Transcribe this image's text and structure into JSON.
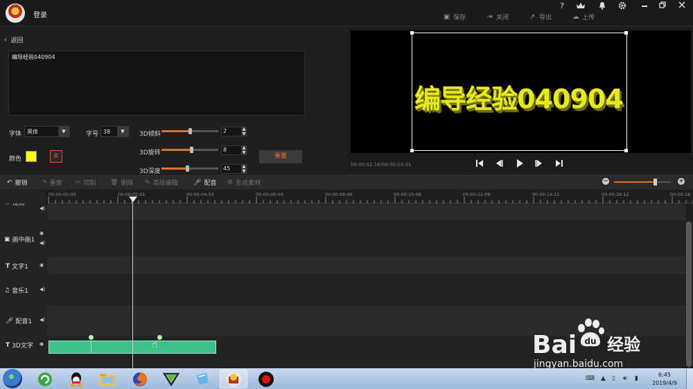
{
  "header": {
    "login": "登录",
    "icons": [
      "help-icon",
      "vip-icon",
      "bell-icon",
      "settings-icon",
      "minimize-icon",
      "restore-icon",
      "close-icon"
    ],
    "help_glyph": "?",
    "actions": [
      {
        "label": "保存",
        "icon": "save-icon"
      },
      {
        "label": "关闭",
        "icon": "exit-icon"
      },
      {
        "label": "导出",
        "icon": "export-icon"
      },
      {
        "label": "上传",
        "icon": "upload-icon"
      }
    ]
  },
  "editor": {
    "back_label": "返回",
    "text_value": "编导经验040904",
    "font_label": "字体",
    "font_value": "黑体",
    "size_label": "字号",
    "size_value": "38",
    "color_label": "颜色",
    "color_value": "#ffff00",
    "bold_label": "B",
    "sliders": [
      {
        "label": "3D倾斜",
        "value": "2",
        "level": 0.5
      },
      {
        "label": "3D旋转",
        "value": "8",
        "level": 0.53
      },
      {
        "label": "3D深度",
        "value": "45",
        "level": 0.45
      }
    ],
    "reset_label": "重置"
  },
  "preview": {
    "text": "编导经验040904",
    "text_color": "#e8e820",
    "timecode": "00:00:02.16/00:00:03.01",
    "controls": [
      "skip-start-icon",
      "step-back-icon",
      "play-icon",
      "step-forward-icon",
      "skip-end-icon"
    ]
  },
  "toolbar": {
    "tools": [
      {
        "label": "撤销",
        "icon": "undo-icon",
        "enabled": true
      },
      {
        "label": "重做",
        "icon": "redo-icon",
        "enabled": false
      },
      {
        "label": "切割",
        "icon": "scissors-icon",
        "enabled": false
      },
      {
        "label": "删除",
        "icon": "trash-icon",
        "enabled": false
      },
      {
        "label": "高级编辑",
        "icon": "pencil-icon",
        "enabled": false
      },
      {
        "label": "配音",
        "icon": "mic-icon",
        "enabled": true
      },
      {
        "label": "生成素材",
        "icon": "material-icon",
        "enabled": false
      }
    ],
    "zoom_level": 0.72
  },
  "timeline": {
    "ticks": [
      "00:00:00:00",
      "00:00:02:01",
      "00:00:04:03",
      "00:00:06:04",
      "00:00:08:06",
      "00:00:10:08",
      "00:00:12:09",
      "00:00:14:11",
      "00:00:16:12",
      "00:00:18"
    ],
    "tracks": [
      {
        "name": "视频",
        "icon": "video-icon"
      },
      {
        "name": "画中画1",
        "icon": "pip-icon"
      },
      {
        "name": "文字1",
        "icon": "text-icon"
      },
      {
        "name": "音乐1",
        "icon": "music-icon"
      },
      {
        "name": "配音1",
        "icon": "mic-icon"
      },
      {
        "name": "3D文字",
        "icon": "text-icon"
      }
    ]
  },
  "taskbar": {
    "apps": [
      "update-app-icon",
      "qq-app-icon",
      "file-explorer-icon",
      "firefox-icon",
      "media-player-icon",
      "dictionary-app-icon",
      "video-editor-app-icon",
      "record-app-icon"
    ],
    "time": "6:45",
    "date": "2019/4/9"
  },
  "watermark": {
    "logo_text": "Bai",
    "logo_suffix": "经验",
    "url": "jingyan.baidu.com"
  }
}
